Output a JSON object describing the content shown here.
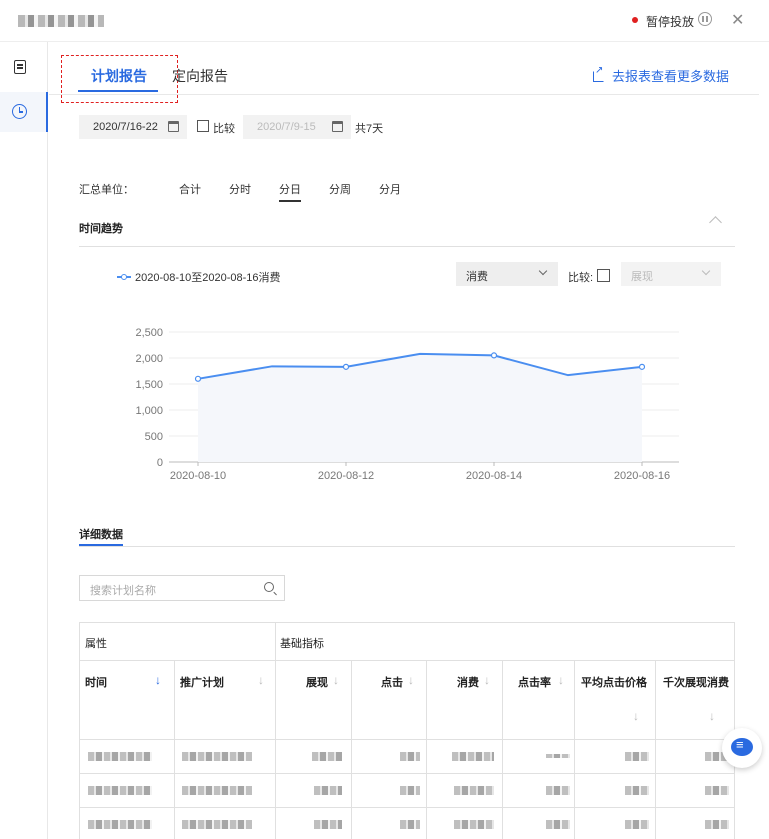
{
  "topbar": {
    "pause_label": "暂停投放"
  },
  "tabs": [
    {
      "label": "计划报告"
    },
    {
      "label": "定向报告"
    }
  ],
  "export_link": "去报表查看更多数据",
  "date_range": {
    "current": "2020/7/16-22",
    "compare_label": "比较",
    "compare_range": "2020/7/9-15",
    "days": "共7天"
  },
  "unit": {
    "label": "汇总单位：",
    "options": [
      "合计",
      "分时",
      "分日",
      "分周",
      "分月"
    ],
    "active": "分日"
  },
  "trend_title": "时间趋势",
  "chart_controls": {
    "metric": "消费",
    "compare_label": "比较:",
    "compare_metric": "展现"
  },
  "chart_data": {
    "type": "line",
    "series": [
      {
        "name": "2020-08-10至2020-08-16消费",
        "values": [
          1600,
          1840,
          1830,
          2080,
          2050,
          1670,
          1830
        ]
      }
    ],
    "x": [
      "2020-08-10",
      "2020-08-11",
      "2020-08-12",
      "2020-08-13",
      "2020-08-14",
      "2020-08-15",
      "2020-08-16"
    ],
    "x_ticks": [
      "2020-08-10",
      "2020-08-12",
      "2020-08-14",
      "2020-08-16"
    ],
    "y_ticks": [
      "0",
      "500",
      "1,000",
      "1,500",
      "2,000",
      "2,500"
    ],
    "ylim": [
      0,
      2500
    ],
    "grid": true,
    "color": "#4a8ef0"
  },
  "detail_title": "详细数据",
  "search_placeholder": "搜索计划名称",
  "table": {
    "group_headers": [
      "属性",
      "基础指标"
    ],
    "columns": [
      "时间",
      "推广计划",
      "展现",
      "点击",
      "消费",
      "点击率",
      "平均点击价格",
      "千次展现消费"
    ]
  }
}
